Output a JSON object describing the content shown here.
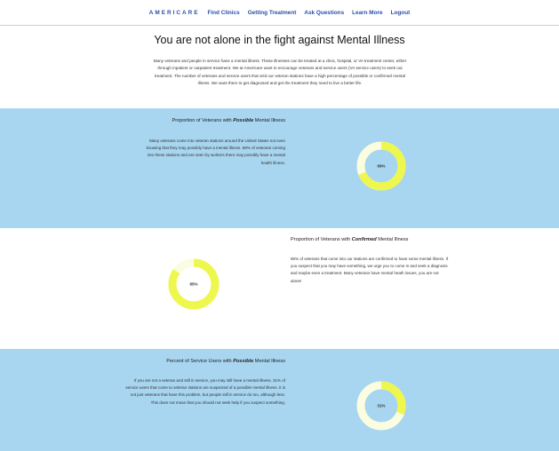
{
  "nav": {
    "brand": "AMERICARE",
    "links": [
      "Find Clinics",
      "Getting Treatment",
      "Ask Questions",
      "Learn More",
      "Logout"
    ]
  },
  "title": "You are not alone in the fight against Mental Illness",
  "intro": "Many veterans and people in service have a mental illness. These illnesses can be treated at a clinic, hospital, or VA treatment center, either through inpatient or outpatient treatment. We at Americare want to encourage veterans and service users (VA service users) to seek out treatment. The number of veterans and service users that visit our veteran stations have a high percentage of possible or confirmed mental illness. We want them to get diagnosed and get the treatment they need to live a better life.",
  "colors": {
    "band": "#a8d5ef",
    "accent": "#eef74e",
    "light": "#fbfde0",
    "link": "#2a4fa8"
  },
  "sections": [
    {
      "heading_pre": "Proportion of Veterans with ",
      "heading_em": "Possible",
      "heading_post": " Mental Illness",
      "text": "Many veterans come into veteran stations around the United States not even knowing that they may possibly have a mental illness. 69% of veterans coming into these stations and are seen by workers there may possibly have a mental health illness.",
      "percent_label": "69%",
      "percent": 69
    },
    {
      "heading_pre": "Proportion of Veterans with ",
      "heading_em": "Confirmed",
      "heading_post": " Mental Illness",
      "text": "85% of veterans that come into our stations are confirmed to have some mental illness. If you suspect that you may have something, we urge you to come in and seek a diagnosis and maybe even a treatment. Many veterans have mental heath issues, you are not alone!",
      "percent_label": "85%",
      "percent": 85
    },
    {
      "heading_pre": "Percent of Service Users with ",
      "heading_em": "Possible",
      "heading_post": " Mental Illness",
      "text": "If you are not a veteran and still in service, you may still have a mental illness. 31% of service users that come to veteran stations are suspected of a possible mental illness. It is not just veterans that have this problem, but people still in service do too, although less. This does not mean that you should not seek help if you suspect something.",
      "percent_label": "31%",
      "percent": 31
    }
  ]
}
